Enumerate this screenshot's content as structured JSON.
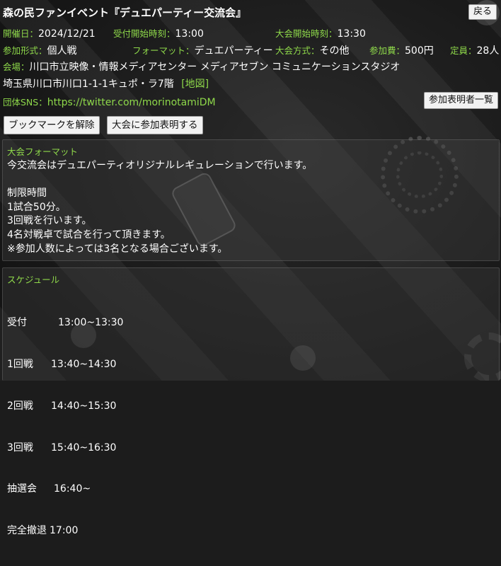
{
  "event": {
    "title": "森の民ファンイベント『デュエパーティー交流会』",
    "back_label": "戻る"
  },
  "info": {
    "date_label": "開催日：",
    "date_value": "2024/12/21",
    "reception_label": "受付開始時刻：",
    "reception_value": "13:00",
    "start_label": "大会開始時刻：",
    "start_value": "13:30",
    "entry_type_label": "参加形式：",
    "entry_type_value": "個人戦",
    "format_label": "フォーマット：",
    "format_value": "デュエパーティー",
    "method_label": "大会方式：",
    "method_value": "その他",
    "fee_label": "参加費：",
    "fee_value": "500円",
    "capacity_label": "定員：",
    "capacity_value": "28人",
    "venue_label": "会場：",
    "venue_value": "川口市立映像・情報メディアセンター メディアセブン コミュニケーションスタジオ",
    "address_value": "埼玉県川口市川口1-1-1キュポ・ラ7階",
    "map_link": "[地図]",
    "sns_label": "団体SNS：",
    "sns_value": "https://twitter.com/morinotamiDM"
  },
  "actions": {
    "participants_list": "参加表明者一覧",
    "bookmark_remove": "ブックマークを解除",
    "join_declare": "大会に参加表明する"
  },
  "format_section": {
    "title": "大会フォーマット",
    "body": "今交流会はデュエパーティオリジナルレギュレーションで行います。\n\n制限時間\n1試合50分。\n3回戦を行います。\n4名対戦卓で試合を行って頂きます。\n※参加人数によっては3名となる場合ございます。"
  },
  "schedule_section": {
    "title": "スケジュール",
    "items": [
      {
        "name": "受付",
        "time": "13:00~13:30"
      },
      {
        "name": "1回戦",
        "time": "13:40~14:30"
      },
      {
        "name": "2回戦",
        "time": "14:40~15:30"
      },
      {
        "name": "3回戦",
        "time": "15:40~16:30"
      },
      {
        "name": "抽選会",
        "time": "16:40~"
      },
      {
        "name": "完全撤退",
        "time": "17:00"
      }
    ]
  }
}
